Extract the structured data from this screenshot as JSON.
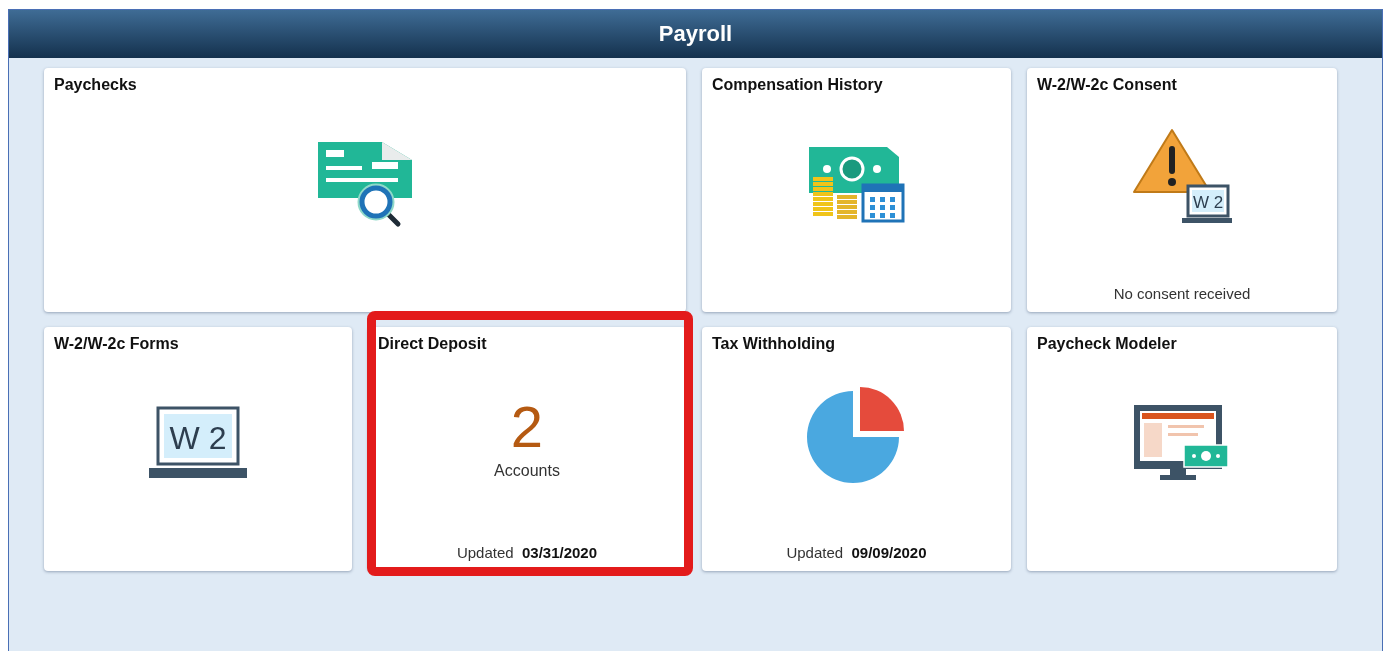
{
  "header": {
    "title": "Payroll"
  },
  "tiles": [
    {
      "title": "Paychecks",
      "kind": "paycheck",
      "highlighted": false
    },
    {
      "title": "Compensation History",
      "kind": "compensation",
      "highlighted": false
    },
    {
      "title": "W-2/W-2c Consent",
      "kind": "warning",
      "icon_text": "W 2",
      "status": "No consent received",
      "highlighted": false
    },
    {
      "title": "W-2/W-2c Forms",
      "kind": "laptop",
      "icon_text": "W 2",
      "highlighted": false
    },
    {
      "title": "Direct Deposit",
      "kind": "count",
      "count": "2",
      "count_label": "Accounts",
      "updated_label": "Updated",
      "updated_date": "03/31/2020",
      "highlighted": true
    },
    {
      "title": "Tax Withholding",
      "kind": "pie",
      "updated_label": "Updated",
      "updated_date": "09/09/2020",
      "highlighted": false
    },
    {
      "title": "Paycheck Modeler",
      "kind": "monitor",
      "highlighted": false
    }
  ]
}
